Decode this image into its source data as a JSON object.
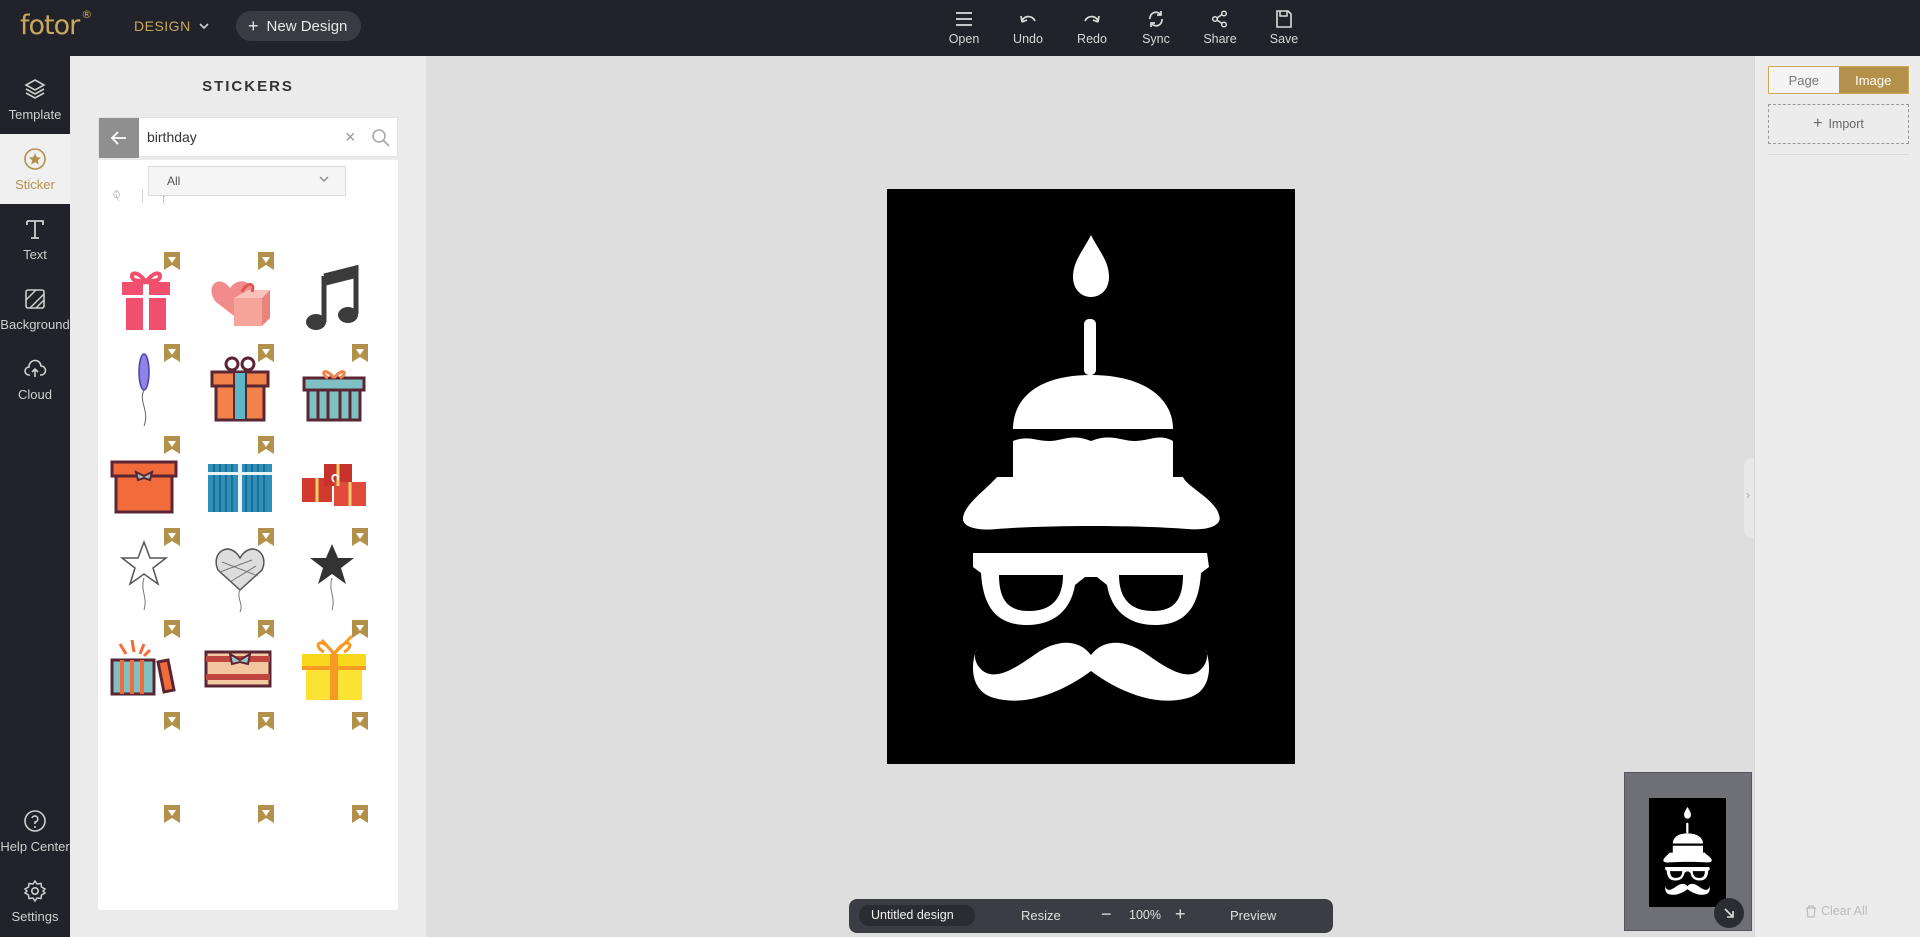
{
  "header": {
    "logo": "fotor",
    "logo_mark": "®",
    "design_menu": "DESIGN",
    "new_design": "New Design",
    "tools": [
      {
        "label": "Open",
        "icon": "menu-icon"
      },
      {
        "label": "Undo",
        "icon": "undo-icon"
      },
      {
        "label": "Redo",
        "icon": "redo-icon"
      },
      {
        "label": "Sync",
        "icon": "sync-icon"
      },
      {
        "label": "Share",
        "icon": "share-icon"
      },
      {
        "label": "Save",
        "icon": "save-icon"
      }
    ]
  },
  "sidebar": {
    "items": [
      {
        "label": "Template",
        "icon": "layers-icon"
      },
      {
        "label": "Sticker",
        "icon": "sticker-icon",
        "active": true
      },
      {
        "label": "Text",
        "icon": "text-icon"
      },
      {
        "label": "Background",
        "icon": "background-icon"
      },
      {
        "label": "Cloud",
        "icon": "cloud-upload-icon"
      }
    ],
    "bottom": [
      {
        "label": "Help Center",
        "icon": "help-icon"
      },
      {
        "label": "Settings",
        "icon": "settings-icon"
      }
    ]
  },
  "stickers": {
    "title": "STICKERS",
    "search_value": "birthday",
    "category": "All",
    "items": [
      "gift",
      "heart-gift",
      "music-note",
      "balloon",
      "gift-box",
      "gift-box-striped",
      "gift-box-orange",
      "gift-box-blue",
      "gift-pile",
      "star-balloon",
      "heart-balloon",
      "star-balloon-dark",
      "gift-open",
      "gift-wrapped",
      "gift-yellow"
    ]
  },
  "canvas": {
    "background": "#000000",
    "artwork": "birthday-hipster-cake"
  },
  "bottom_bar": {
    "title": "Untitled design",
    "resize": "Resize",
    "minus": "−",
    "zoom": "100%",
    "plus": "+",
    "preview": "Preview"
  },
  "right_panel": {
    "tabs": [
      "Page",
      "Image"
    ],
    "active_tab": "Image",
    "import": "Import",
    "clear_all": "Clear All"
  },
  "colors": {
    "accent": "#b4914a",
    "chrome": "#22232a"
  }
}
